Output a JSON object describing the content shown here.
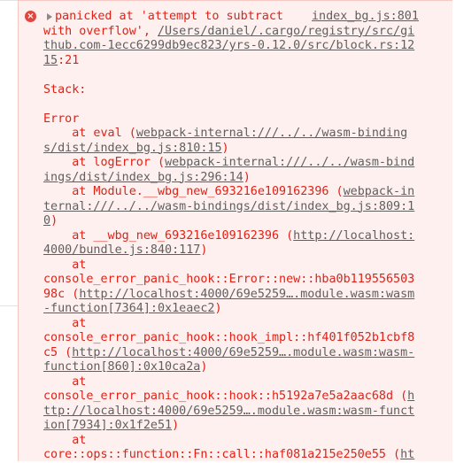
{
  "message": {
    "error_icon_glyph": "×",
    "source_link": "index_bg.js:801",
    "lines": [
      {
        "parts": [
          {
            "t": "panicked at 'attempt to subtract"
          }
        ]
      },
      {
        "parts": [
          {
            "t": "with overflow', "
          },
          {
            "t": "/Users/daniel/.cargo/registry/src/gi",
            "link": true
          }
        ]
      },
      {
        "parts": [
          {
            "t": "thub.com-1ecc6299db9ec823/yrs-0.12.0/src/block.rs:12",
            "link": true
          }
        ]
      },
      {
        "parts": [
          {
            "t": "15",
            "link": true
          },
          {
            "t": ":21"
          }
        ]
      },
      {
        "parts": [
          {
            "t": ""
          }
        ]
      },
      {
        "parts": [
          {
            "t": "Stack:"
          }
        ]
      },
      {
        "parts": [
          {
            "t": ""
          }
        ]
      },
      {
        "parts": [
          {
            "t": "Error"
          }
        ]
      },
      {
        "parts": [
          {
            "t": "    at eval ("
          },
          {
            "t": "webpack-internal:///../../wasm-binding",
            "link": true
          }
        ]
      },
      {
        "parts": [
          {
            "t": "s/dist/index_bg.js:810:15",
            "link": true
          },
          {
            "t": ")"
          }
        ]
      },
      {
        "parts": [
          {
            "t": "    at logError ("
          },
          {
            "t": "webpack-internal:///../../wasm-bind",
            "link": true
          }
        ]
      },
      {
        "parts": [
          {
            "t": "ings/dist/index_bg.js:296:14",
            "link": true
          },
          {
            "t": ")"
          }
        ]
      },
      {
        "parts": [
          {
            "t": "    at Module.__wbg_new_693216e109162396 ("
          },
          {
            "t": "webpack-in",
            "link": true
          }
        ]
      },
      {
        "parts": [
          {
            "t": "ternal:///../../wasm-bindings/dist/index_bg.js:809:1",
            "link": true
          }
        ]
      },
      {
        "parts": [
          {
            "t": "0",
            "link": true
          },
          {
            "t": ")"
          }
        ]
      },
      {
        "parts": [
          {
            "t": "    at __wbg_new_693216e109162396 ("
          },
          {
            "t": "http://localhost:",
            "link": true
          }
        ]
      },
      {
        "parts": [
          {
            "t": "4000/bundle.js:840:117",
            "link": true
          },
          {
            "t": ")"
          }
        ]
      },
      {
        "parts": [
          {
            "t": "    at"
          }
        ]
      },
      {
        "parts": [
          {
            "t": "console_error_panic_hook::Error::new::hba0b119556503"
          }
        ]
      },
      {
        "parts": [
          {
            "t": "98c ("
          },
          {
            "t": "http://localhost:4000/69e5259….module.wasm:wasm",
            "link": true
          }
        ]
      },
      {
        "parts": [
          {
            "t": "-function[7364]:0x1eaec2",
            "link": true
          },
          {
            "t": ")"
          }
        ]
      },
      {
        "parts": [
          {
            "t": "    at"
          }
        ]
      },
      {
        "parts": [
          {
            "t": "console_error_panic_hook::hook_impl::hf401f052b1cbf8"
          }
        ]
      },
      {
        "parts": [
          {
            "t": "c5 ("
          },
          {
            "t": "http://localhost:4000/69e5259….module.wasm:wasm-",
            "link": true
          }
        ]
      },
      {
        "parts": [
          {
            "t": "function[860]:0x10ca2a",
            "link": true
          },
          {
            "t": ")"
          }
        ]
      },
      {
        "parts": [
          {
            "t": "    at"
          }
        ]
      },
      {
        "parts": [
          {
            "t": "console_error_panic_hook::hook::h5192a7e5a2aac68d ("
          },
          {
            "t": "h",
            "link": true
          }
        ]
      },
      {
        "parts": [
          {
            "t": "ttp://localhost:4000/69e5259….module.wasm:wasm-funct",
            "link": true
          }
        ]
      },
      {
        "parts": [
          {
            "t": "ion[7934]:0x1f2e51",
            "link": true
          },
          {
            "t": ")"
          }
        ]
      },
      {
        "parts": [
          {
            "t": "    at"
          }
        ]
      },
      {
        "parts": [
          {
            "t": "core::ops::function::Fn::call::haf081a215e250e55 ("
          },
          {
            "t": "ht",
            "link": true
          }
        ]
      }
    ]
  }
}
